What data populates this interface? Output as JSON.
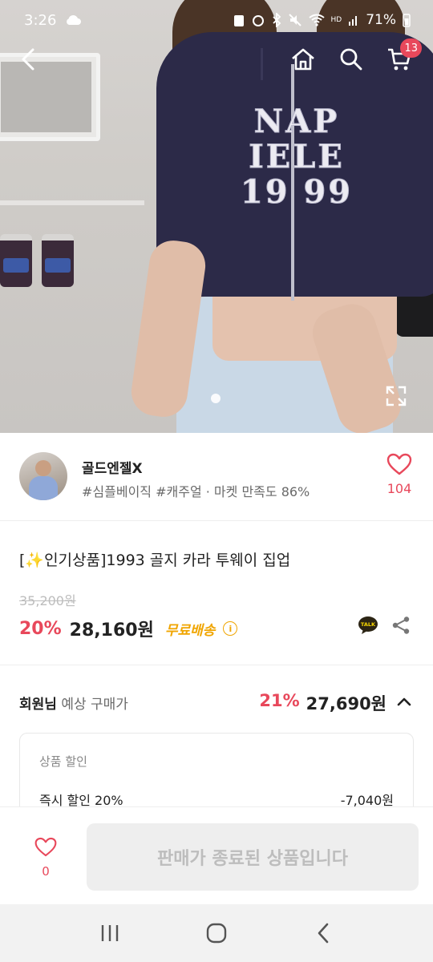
{
  "status_bar": {
    "time": "3:26",
    "battery": "71%",
    "signal": "HD"
  },
  "nav": {
    "cart_count": "13"
  },
  "hero": {
    "shirt_text_line1": "NAP IELE",
    "shirt_text_line2": "19 99"
  },
  "seller": {
    "name": "골드엔젤X",
    "tags": "#심플베이직 #캐주얼 · 마켓 만족도 86%",
    "like_count": "104"
  },
  "product": {
    "title": "[✨인기상품]1993 골지 카라 투웨이 집업",
    "original_price": "35,200원",
    "discount": "20%",
    "price": "28,160원",
    "shipping": "무료배송",
    "talk_label": "TALK"
  },
  "member": {
    "label_bold": "회원님",
    "label_rest": "예상 구매가",
    "discount": "21%",
    "price": "27,690원",
    "box_title": "상품 할인",
    "row_label": "즉시 할인 20%",
    "row_value": "-7,040원"
  },
  "action_bar": {
    "like_count": "0",
    "button_label": "판매가 종료된 상품입니다"
  },
  "colors": {
    "accent": "#e8485b",
    "shipping": "#f0a500",
    "disabled_bg": "#eeeeee"
  },
  "icons": [
    "back-icon",
    "home-icon",
    "search-icon",
    "cart-icon",
    "expand-icon",
    "heart-icon",
    "kakao-talk-icon",
    "share-icon",
    "chevron-up-icon",
    "recent-apps-icon",
    "home-nav-icon",
    "back-nav-icon"
  ]
}
